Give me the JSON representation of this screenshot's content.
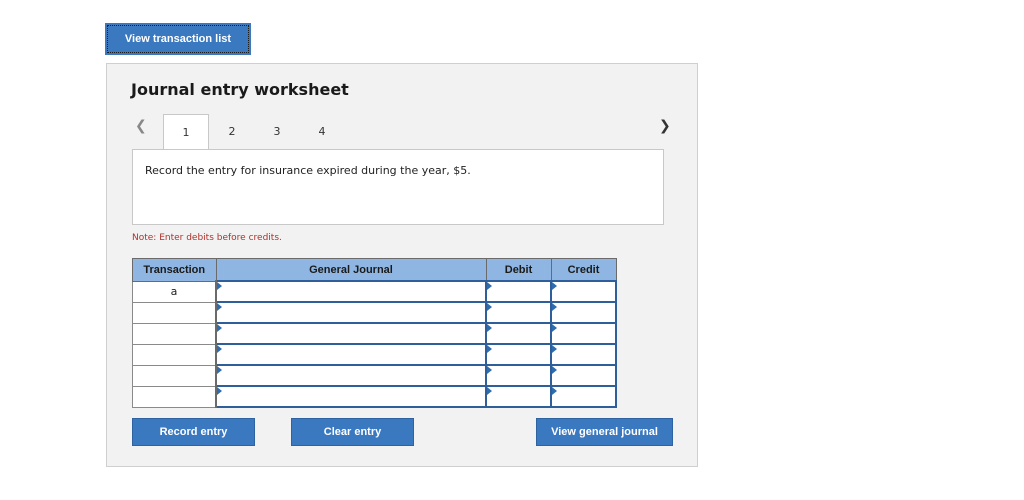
{
  "top_button": "View transaction list",
  "worksheet": {
    "title": "Journal entry worksheet",
    "tabs": [
      "1",
      "2",
      "3",
      "4"
    ],
    "active_tab": "1",
    "prev_icon": "chevron-left-icon",
    "next_icon": "chevron-right-icon",
    "description": "Record the entry for insurance expired during the year, $5.",
    "note": "Note: Enter debits before credits."
  },
  "table": {
    "headers": [
      "Transaction",
      "General Journal",
      "Debit",
      "Credit"
    ],
    "rows": [
      {
        "transaction": "a",
        "account": "",
        "debit": "",
        "credit": ""
      },
      {
        "transaction": "",
        "account": "",
        "debit": "",
        "credit": ""
      },
      {
        "transaction": "",
        "account": "",
        "debit": "",
        "credit": ""
      },
      {
        "transaction": "",
        "account": "",
        "debit": "",
        "credit": ""
      },
      {
        "transaction": "",
        "account": "",
        "debit": "",
        "credit": ""
      },
      {
        "transaction": "",
        "account": "",
        "debit": "",
        "credit": ""
      }
    ]
  },
  "buttons": {
    "record": "Record entry",
    "clear": "Clear entry",
    "view_journal": "View general journal"
  },
  "colors": {
    "button_blue": "#3a78c0",
    "header_blue": "#8fb6e2",
    "note_red": "#b0302a"
  }
}
